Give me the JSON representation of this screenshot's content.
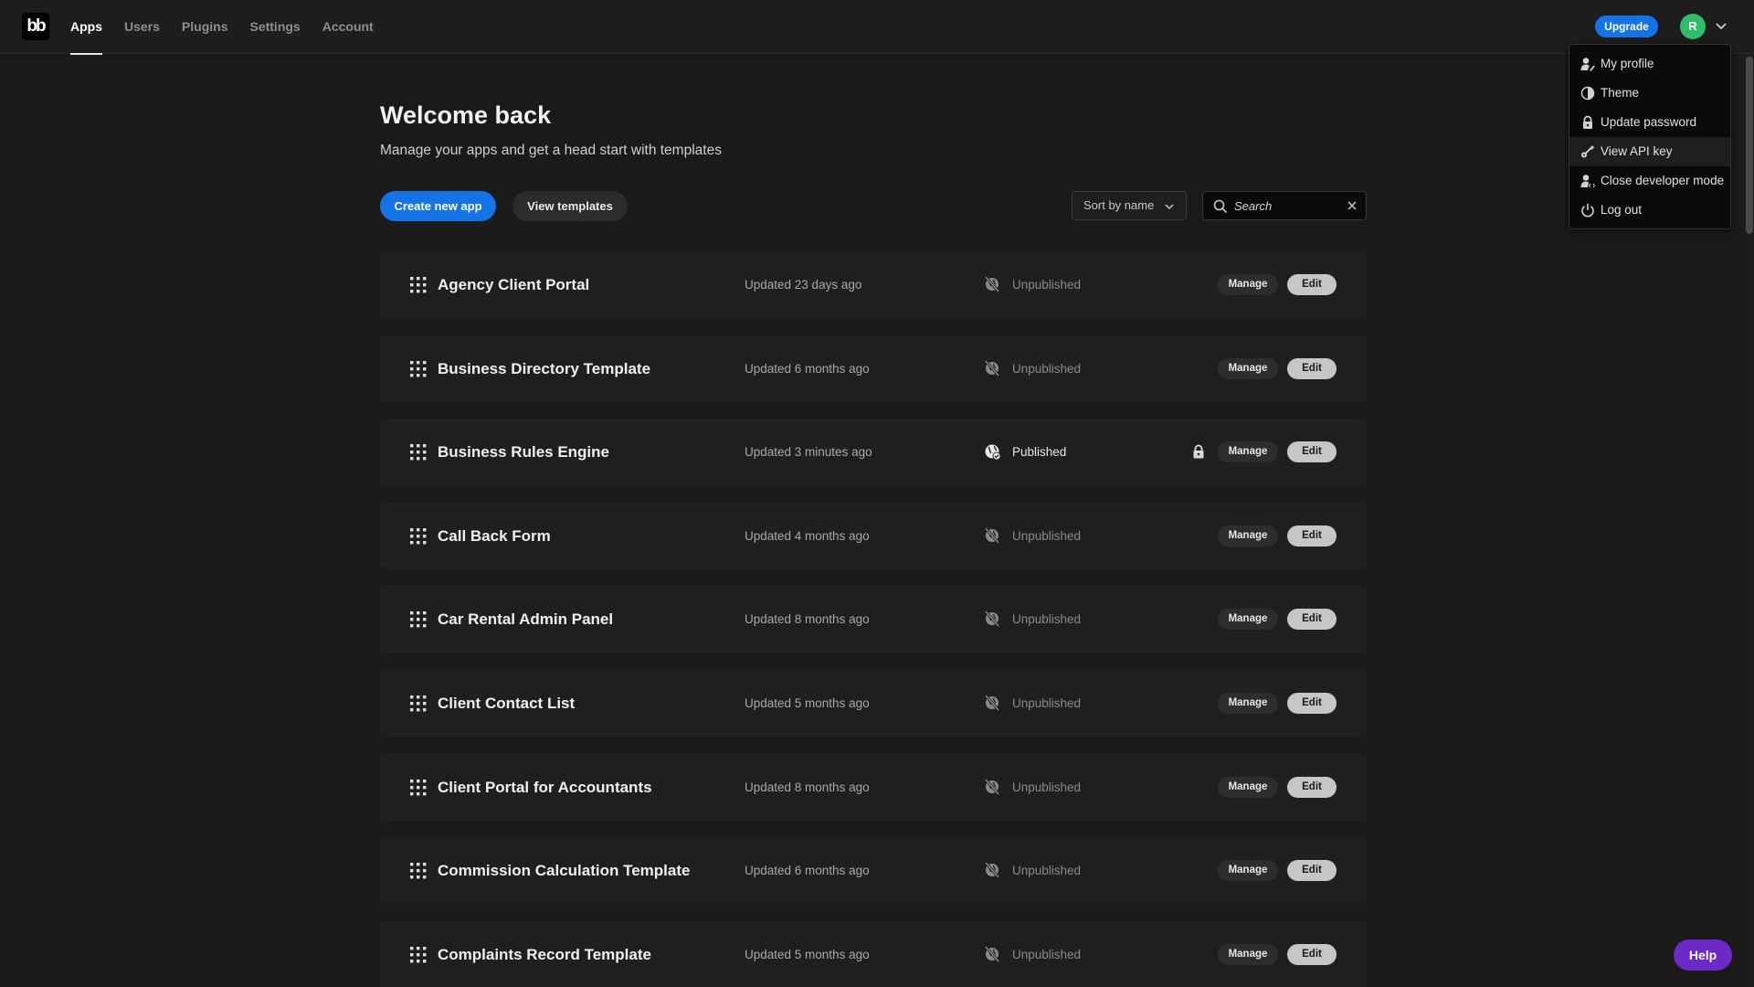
{
  "brand": {
    "logo_text": "bb"
  },
  "nav": {
    "items": [
      {
        "label": "Apps",
        "active": true
      },
      {
        "label": "Users",
        "active": false
      },
      {
        "label": "Plugins",
        "active": false
      },
      {
        "label": "Settings",
        "active": false
      },
      {
        "label": "Account",
        "active": false
      }
    ]
  },
  "header_right": {
    "upgrade_label": "Upgrade",
    "avatar_initial": "R",
    "avatar_color": "#2ebe6a"
  },
  "user_menu": {
    "items": [
      {
        "label": "My profile",
        "icon": "user-edit-icon"
      },
      {
        "label": "Theme",
        "icon": "contrast-icon"
      },
      {
        "label": "Update password",
        "icon": "lock-icon"
      },
      {
        "label": "View API key",
        "icon": "key-icon",
        "hovered": true
      },
      {
        "label": "Close developer mode",
        "icon": "user-code-icon"
      },
      {
        "label": "Log out",
        "icon": "power-icon"
      }
    ]
  },
  "main": {
    "title": "Welcome back",
    "subtitle": "Manage your apps and get a head start with templates",
    "create_label": "Create new app",
    "templates_label": "View templates",
    "sort_label": "Sort by name",
    "search_placeholder": "Search",
    "search_value": ""
  },
  "apps": [
    {
      "name": "Agency Client Portal",
      "updated": "Updated 23 days ago",
      "status": "Unpublished",
      "locked": false
    },
    {
      "name": "Business Directory Template",
      "updated": "Updated 6 months ago",
      "status": "Unpublished",
      "locked": false
    },
    {
      "name": "Business Rules Engine",
      "updated": "Updated 3 minutes ago",
      "status": "Published",
      "locked": true
    },
    {
      "name": "Call Back Form",
      "updated": "Updated 4 months ago",
      "status": "Unpublished",
      "locked": false
    },
    {
      "name": "Car Rental Admin Panel",
      "updated": "Updated 8 months ago",
      "status": "Unpublished",
      "locked": false
    },
    {
      "name": "Client Contact List",
      "updated": "Updated 5 months ago",
      "status": "Unpublished",
      "locked": false
    },
    {
      "name": "Client Portal for Accountants",
      "updated": "Updated 8 months ago",
      "status": "Unpublished",
      "locked": false
    },
    {
      "name": "Commission Calculation Template",
      "updated": "Updated 6 months ago",
      "status": "Unpublished",
      "locked": false
    },
    {
      "name": "Complaints Record Template",
      "updated": "Updated 5 months ago",
      "status": "Unpublished",
      "locked": false
    }
  ],
  "row_actions": {
    "manage_label": "Manage",
    "edit_label": "Edit"
  },
  "help_label": "Help",
  "colors": {
    "accent": "#1473e6",
    "help": "#6d28c8",
    "background": "#1a1a1a"
  }
}
